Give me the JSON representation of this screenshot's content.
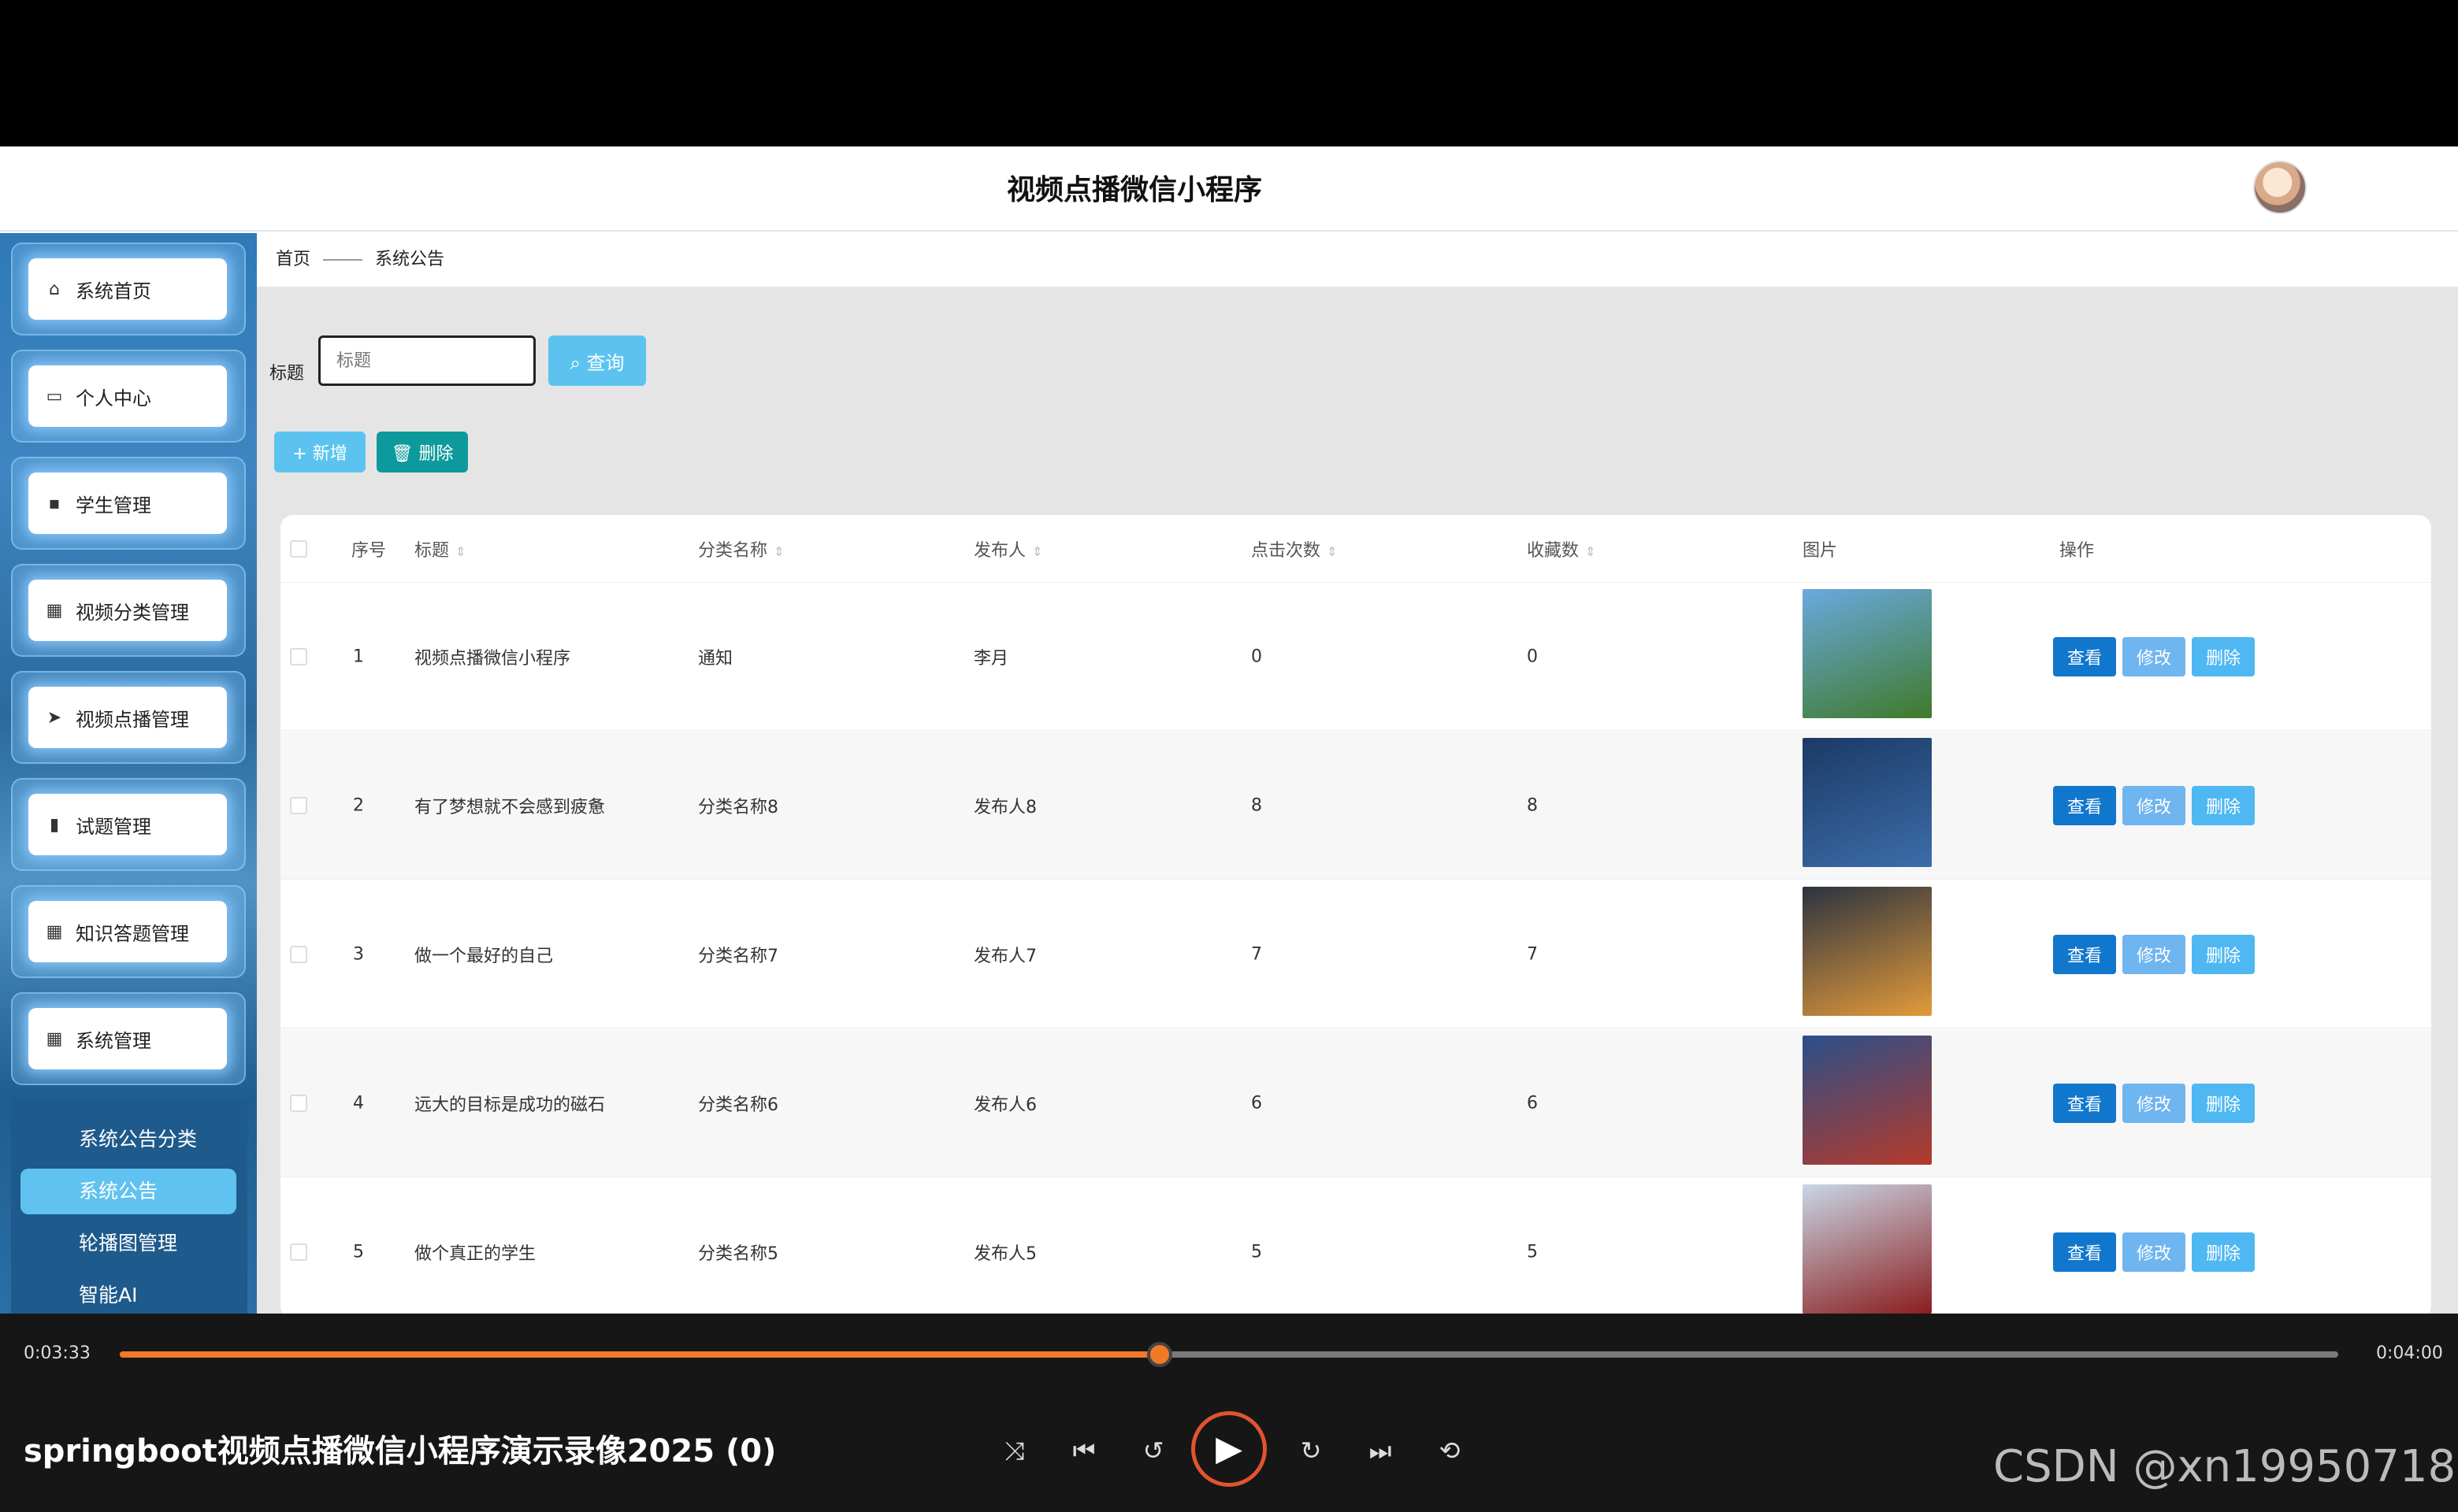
{
  "app": {
    "title": "视频点播微信小程序"
  },
  "sidebar": {
    "items": [
      {
        "label": "系统首页",
        "icon": "home-icon",
        "glyph": "⌂"
      },
      {
        "label": "个人中心",
        "icon": "card-icon",
        "glyph": "▭"
      },
      {
        "label": "学生管理",
        "icon": "chat-icon",
        "glyph": "▪"
      },
      {
        "label": "视频分类管理",
        "icon": "grid-icon",
        "glyph": "▦"
      },
      {
        "label": "视频点播管理",
        "icon": "send-icon",
        "glyph": "➤"
      },
      {
        "label": "试题管理",
        "icon": "bar-chart-icon",
        "glyph": "▮"
      },
      {
        "label": "知识答题管理",
        "icon": "apps-icon",
        "glyph": "▦"
      },
      {
        "label": "系统管理",
        "icon": "apps-icon",
        "glyph": "▦"
      }
    ],
    "submenu": [
      "系统公告分类",
      "系统公告",
      "轮播图管理",
      "智能AI"
    ],
    "active_sub": "系统公告"
  },
  "breadcrumb": {
    "home": "首页",
    "current": "系统公告"
  },
  "search": {
    "label": "标题",
    "placeholder": "标题",
    "button": "查询",
    "button_icon": "search-icon"
  },
  "toolbar": {
    "add": "新增",
    "delete": "删除"
  },
  "table": {
    "headers": [
      "序号",
      "标题",
      "分类名称",
      "发布人",
      "点击次数",
      "收藏数",
      "图片",
      "操作"
    ],
    "actions": {
      "view": "查看",
      "edit": "修改",
      "delete": "删除"
    },
    "rows": [
      {
        "index": "1",
        "title": "视频点播微信小程序",
        "category": "通知",
        "publisher": "李月",
        "clicks": "0",
        "favorites": "0",
        "thumb_colors": [
          "#6aa9e0",
          "#3f7a2a"
        ]
      },
      {
        "index": "2",
        "title": "有了梦想就不会感到疲惫",
        "category": "分类名称8",
        "publisher": "发布人8",
        "clicks": "8",
        "favorites": "8",
        "thumb_colors": [
          "#1b3a66",
          "#3c6da8"
        ]
      },
      {
        "index": "3",
        "title": "做一个最好的自己",
        "category": "分类名称7",
        "publisher": "发布人7",
        "clicks": "7",
        "favorites": "7",
        "thumb_colors": [
          "#2b3340",
          "#e39a3a"
        ]
      },
      {
        "index": "4",
        "title": "远大的目标是成功的磁石",
        "category": "分类名称6",
        "publisher": "发布人6",
        "clicks": "6",
        "favorites": "6",
        "thumb_colors": [
          "#2b4f8a",
          "#b43a2a"
        ]
      },
      {
        "index": "5",
        "title": "做个真正的学生",
        "category": "分类名称5",
        "publisher": "发布人5",
        "clicks": "5",
        "favorites": "5",
        "thumb_colors": [
          "#c9d6e6",
          "#8a1e1e"
        ]
      }
    ]
  },
  "player": {
    "current_time": "0:03:33",
    "total_time": "0:04:00",
    "progress": 0.4688,
    "video_title": "springboot视频点播微信小程序演示录像2025 (0)",
    "controls": [
      "shuffle-icon",
      "previous-icon",
      "rewind-10-icon",
      "play-icon",
      "forward-30-icon",
      "next-icon",
      "repeat-off-icon"
    ]
  },
  "watermark": "CSDN @xn19950718",
  "colors": {
    "accent": "#5cc3f0",
    "view": "#1177cc",
    "delete_btn": "#0e9a9c",
    "progress": "#f07a28"
  }
}
